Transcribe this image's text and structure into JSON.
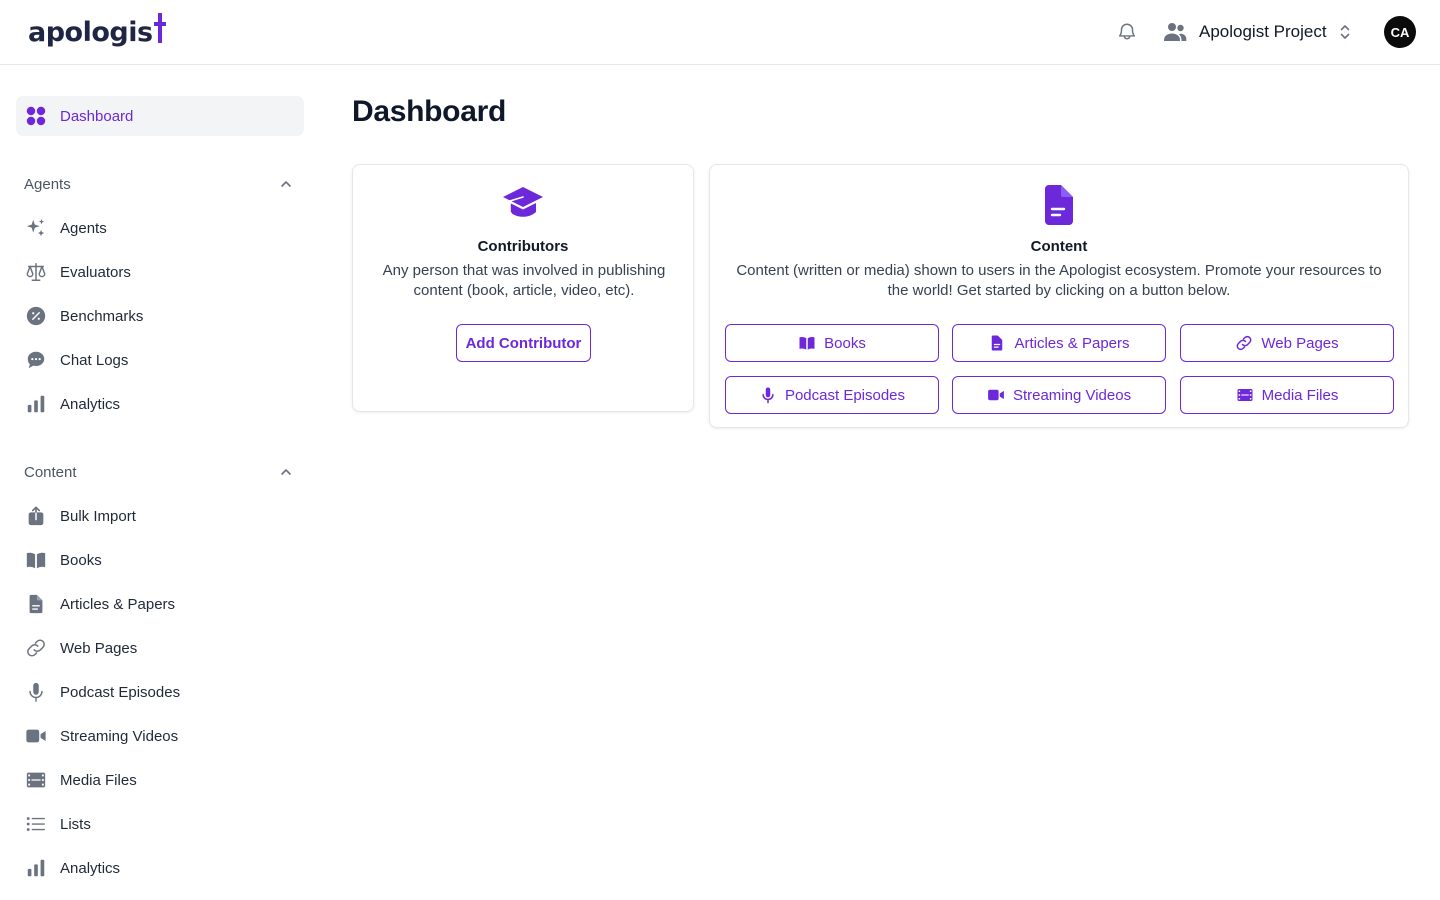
{
  "header": {
    "logo_text": "apologis",
    "project_name": "Apologist Project",
    "avatar_initials": "CA",
    "accent_color": "#6d28d9"
  },
  "sidebar": {
    "dashboard_label": "Dashboard",
    "agents_section": {
      "title": "Agents",
      "items": [
        {
          "label": "Agents",
          "icon": "sparkles-icon"
        },
        {
          "label": "Evaluators",
          "icon": "scale-icon"
        },
        {
          "label": "Benchmarks",
          "icon": "badge-percent-icon"
        },
        {
          "label": "Chat Logs",
          "icon": "chat-icon"
        },
        {
          "label": "Analytics",
          "icon": "bar-chart-icon"
        }
      ]
    },
    "content_section": {
      "title": "Content",
      "items": [
        {
          "label": "Bulk Import",
          "icon": "upload-icon"
        },
        {
          "label": "Books",
          "icon": "book-icon"
        },
        {
          "label": "Articles & Papers",
          "icon": "document-icon"
        },
        {
          "label": "Web Pages",
          "icon": "link-icon"
        },
        {
          "label": "Podcast Episodes",
          "icon": "microphone-icon"
        },
        {
          "label": "Streaming Videos",
          "icon": "video-icon"
        },
        {
          "label": "Media Files",
          "icon": "film-icon"
        },
        {
          "label": "Lists",
          "icon": "list-icon"
        },
        {
          "label": "Analytics",
          "icon": "bar-chart-icon"
        }
      ]
    }
  },
  "main": {
    "title": "Dashboard",
    "contributors_card": {
      "title": "Contributors",
      "description": "Any person that was involved in publishing content (book, article, video, etc).",
      "button_label": "Add Contributor"
    },
    "content_card": {
      "title": "Content",
      "description": "Content (written or media) shown to users in the Apologist ecosystem. Promote your resources to the world! Get started by clicking on a button below.",
      "buttons": [
        {
          "label": "Books",
          "icon": "book-icon"
        },
        {
          "label": "Articles & Papers",
          "icon": "document-icon"
        },
        {
          "label": "Web Pages",
          "icon": "link-icon"
        },
        {
          "label": "Podcast Episodes",
          "icon": "microphone-icon"
        },
        {
          "label": "Streaming Videos",
          "icon": "video-icon"
        },
        {
          "label": "Media Files",
          "icon": "film-icon"
        }
      ]
    }
  }
}
